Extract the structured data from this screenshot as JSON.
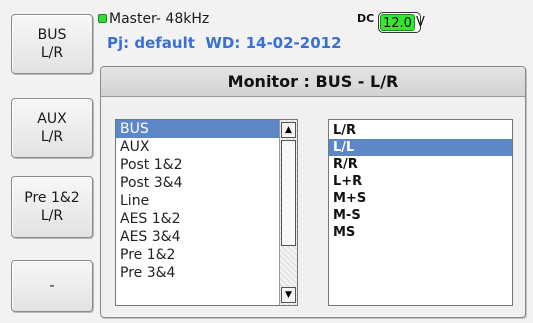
{
  "side_buttons": [
    {
      "label": "BUS\nL/R"
    },
    {
      "label": "AUX\nL/R"
    },
    {
      "label": "Pre 1&2\nL/R"
    },
    {
      "label": "-"
    }
  ],
  "status": {
    "master": "Master- 48kHz",
    "dc_label": "DC",
    "dc_value": "12.0",
    "dc_unit": "V",
    "project": "Pj: default  WD: 14-02-2012"
  },
  "monitor": {
    "title": "Monitor : BUS - L/R",
    "sources": [
      "BUS",
      "AUX",
      "Post 1&2",
      "Post 3&4",
      "Line",
      "AES 1&2",
      "AES 3&4",
      "Pre 1&2",
      "Pre 3&4"
    ],
    "selected_source": "BUS",
    "modes": [
      "L/R",
      "L/L",
      "R/R",
      "L+R",
      "M+S",
      "M-S",
      "MS"
    ],
    "selected_mode": "L/L"
  },
  "colors": {
    "accent_blue": "#3a6fd8",
    "selection": "#5d86c6",
    "battery_green": "#33e633",
    "status_led": "#2ee12e"
  }
}
